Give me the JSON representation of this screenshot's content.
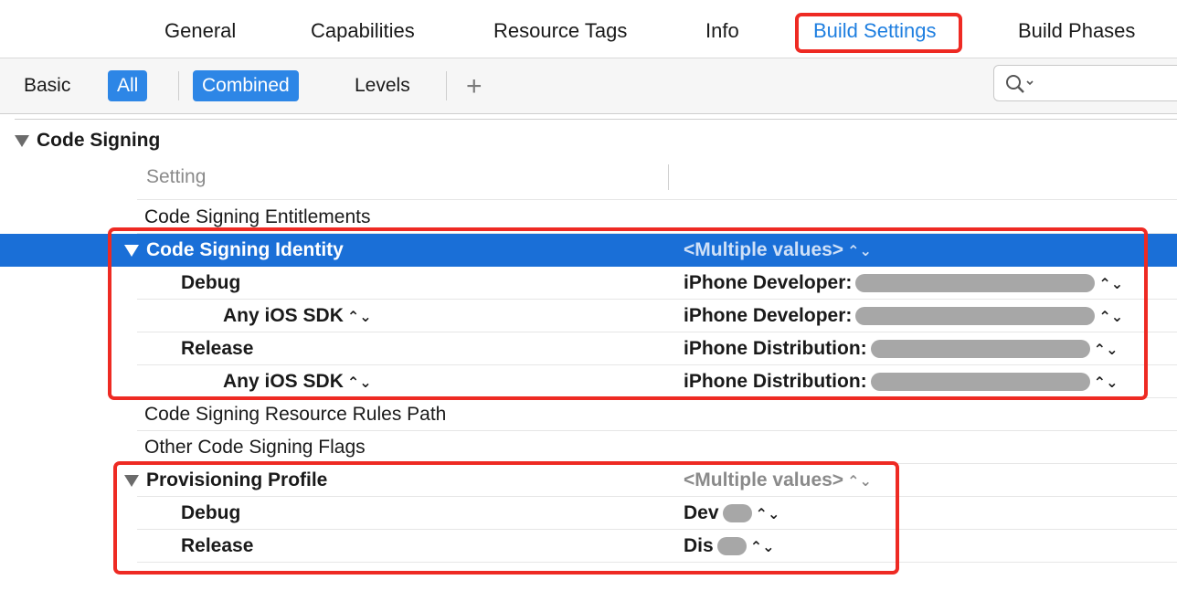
{
  "tabs": [
    {
      "label": "General",
      "active": false
    },
    {
      "label": "Capabilities",
      "active": false
    },
    {
      "label": "Resource Tags",
      "active": false
    },
    {
      "label": "Info",
      "active": false
    },
    {
      "label": "Build Settings",
      "active": true
    },
    {
      "label": "Build Phases",
      "active": false
    }
  ],
  "filters": {
    "basic": "Basic",
    "all": "All",
    "combined": "Combined",
    "levels": "Levels",
    "add": "+"
  },
  "section": {
    "title": "Code Signing",
    "column_header": "Setting"
  },
  "rows": {
    "entitlements": {
      "label": "Code Signing Entitlements"
    },
    "identity": {
      "label": "Code Signing Identity",
      "value": "<Multiple values>"
    },
    "identity_debug": {
      "label": "Debug",
      "value": "iPhone Developer:"
    },
    "identity_debug_sdk": {
      "label": "Any iOS SDK",
      "value": "iPhone Developer:"
    },
    "identity_release": {
      "label": "Release",
      "value": "iPhone Distribution:"
    },
    "identity_release_sdk": {
      "label": "Any iOS SDK",
      "value": "iPhone Distribution:"
    },
    "resource_rules": {
      "label": "Code Signing Resource Rules Path"
    },
    "other_flags": {
      "label": "Other Code Signing Flags"
    },
    "provisioning": {
      "label": "Provisioning Profile",
      "value": "<Multiple values>"
    },
    "prov_debug": {
      "label": "Debug",
      "value": "Dev"
    },
    "prov_release": {
      "label": "Release",
      "value": "Dis"
    }
  },
  "icons": {
    "stepper": "⌃⌄ stepper-icon",
    "disclosure": "disclosure-triangle-icon",
    "search": "search-icon"
  },
  "colors": {
    "accent": "#1f7fe0",
    "selection": "#1a6fd7",
    "highlight": "#ee2a23"
  }
}
